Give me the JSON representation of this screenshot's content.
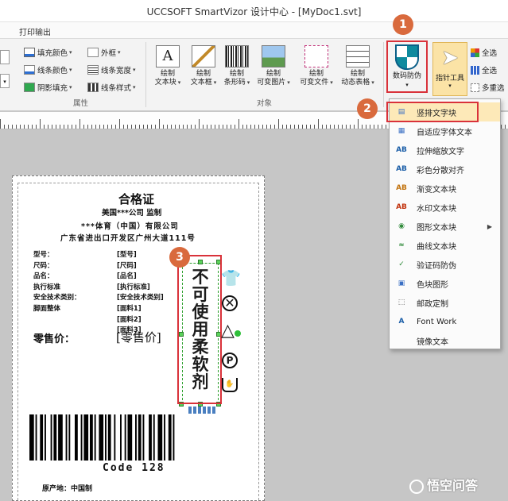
{
  "window": {
    "title": "UCCSOFT SmartVizor 设计中心 - [MyDoc1.svt]"
  },
  "tabs": {
    "print": "打印输出"
  },
  "ribbon": {
    "props": {
      "fill_color": "填充颜色",
      "line_color": "线条颜色",
      "shadow_fill": "阴影填充",
      "frame": "外框",
      "line_width": "线条宽度",
      "line_style": "线条样式",
      "group_label": "属性"
    },
    "objects": {
      "group_label": "对象",
      "buttons": [
        {
          "l1": "绘制",
          "l2": "文本块"
        },
        {
          "l1": "绘制",
          "l2": "文本框"
        },
        {
          "l1": "绘制",
          "l2": "条形码"
        },
        {
          "l1": "绘制",
          "l2": "可变图片"
        },
        {
          "l1": "绘制",
          "l2": "可变文件"
        },
        {
          "l1": "绘制",
          "l2": "动态表格"
        }
      ]
    },
    "anti_fake": "数码防伪",
    "pointer_tool": "指针工具",
    "select_all": "全选",
    "select_all2": "全选",
    "multi_select": "多重选",
    "badge1": "1",
    "badge2": "2",
    "badge3": "3"
  },
  "menu": {
    "items": [
      {
        "icon": "▤",
        "label": "竖排文字块",
        "highlighted": true
      },
      {
        "icon": "▦",
        "label": "自适应字体文本"
      },
      {
        "icon": "AB",
        "label": "拉伸缩放文字"
      },
      {
        "icon": "AB",
        "label": "彩色分散对齐"
      },
      {
        "icon": "AB",
        "label": "渐变文本块"
      },
      {
        "icon": "AB",
        "label": "水印文本块"
      },
      {
        "icon": "◉",
        "label": "图形文本块",
        "submenu": true
      },
      {
        "icon": "≈",
        "label": "曲线文本块"
      },
      {
        "icon": "✓",
        "label": "验证码防伪"
      },
      {
        "icon": "▣",
        "label": "色块图形"
      },
      {
        "icon": "⬚",
        "label": "邮政定制"
      },
      {
        "icon": "A",
        "label": "Font Work"
      },
      {
        "icon": "",
        "label": "镜像文本"
      }
    ]
  },
  "label": {
    "title": "合格证",
    "supervisor": "美国***公司 监制",
    "company": "***体育（中国）有限公司",
    "address": "广东省进出口开发区广州大道111号",
    "rows": [
      {
        "k": "型号：",
        "v": "[型号]"
      },
      {
        "k": "尺码：",
        "v": "[尺码]"
      },
      {
        "k": "品名：",
        "v": "[品名]"
      },
      {
        "k": "执行标准",
        "v": "[执行标准]"
      },
      {
        "k": "安全技术类别：",
        "v": "[安全技术类别]"
      },
      {
        "k": "脚面整体",
        "v": "[面料1]"
      },
      {
        "k": "",
        "v": "[面料2]"
      },
      {
        "k": "",
        "v": "[面料3]"
      }
    ],
    "price_label": "零售价：",
    "price_value": "[零售价]",
    "vertical_text": "不可使用柔软剂",
    "barcode_caption": "Code  128",
    "origin": "原产地：中国制"
  },
  "watermark": "悟空问答",
  "colors": {
    "highlight_red": "#d9323a",
    "badge_orange": "#d96a3d",
    "menu_hover": "#fde9b8",
    "pointer_bg": "#fbe3a6"
  }
}
